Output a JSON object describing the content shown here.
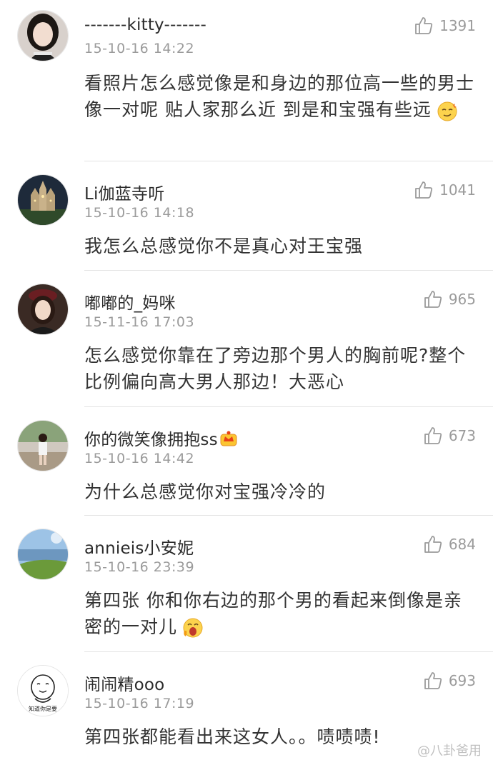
{
  "comments": [
    {
      "username": "-------kitty-------",
      "time": "15-10-16 14:22",
      "likes": "1391",
      "text": "看照片怎么感觉像是和身边的那位高一些的男士像一对呢 贴人家那么近 到是和宝强有些远",
      "emoji": "smirk-emoji"
    },
    {
      "username": "Li伽蓝寺听",
      "time": "15-10-16 14:18",
      "likes": "1041",
      "text": "我怎么总感觉你不是真心对王宝强"
    },
    {
      "username": "嘟嘟的_妈咪",
      "time": "15-11-16 17:03",
      "likes": "965",
      "text": "怎么感觉你靠在了旁边那个男人的胸前呢?整个比例偏向高大男人那边！大恶心"
    },
    {
      "username": "你的微笑像拥抱ss",
      "username_badge": "crown-icon",
      "time": "15-10-16 14:42",
      "likes": "673",
      "text": "为什么总感觉你对宝强冷冷的"
    },
    {
      "username": "annieis小安妮",
      "time": "15-10-16 23:39",
      "likes": "684",
      "text": "第四张 你和你右边的那个男的看起来倒像是亲密的一对儿",
      "emoji": "shocked-emoji"
    },
    {
      "username": "闹闹精ooo",
      "time": "15-10-16 17:19",
      "likes": "693",
      "text": "第四张都能看出来这女人。。啧啧啧!"
    }
  ],
  "avatar_caption": "知道你是要",
  "watermark": "@八卦爸用",
  "colors": {
    "username": "#2b2b2b",
    "meta": "#9b9b9b",
    "text": "#333333",
    "divider": "#e3e3e3"
  }
}
